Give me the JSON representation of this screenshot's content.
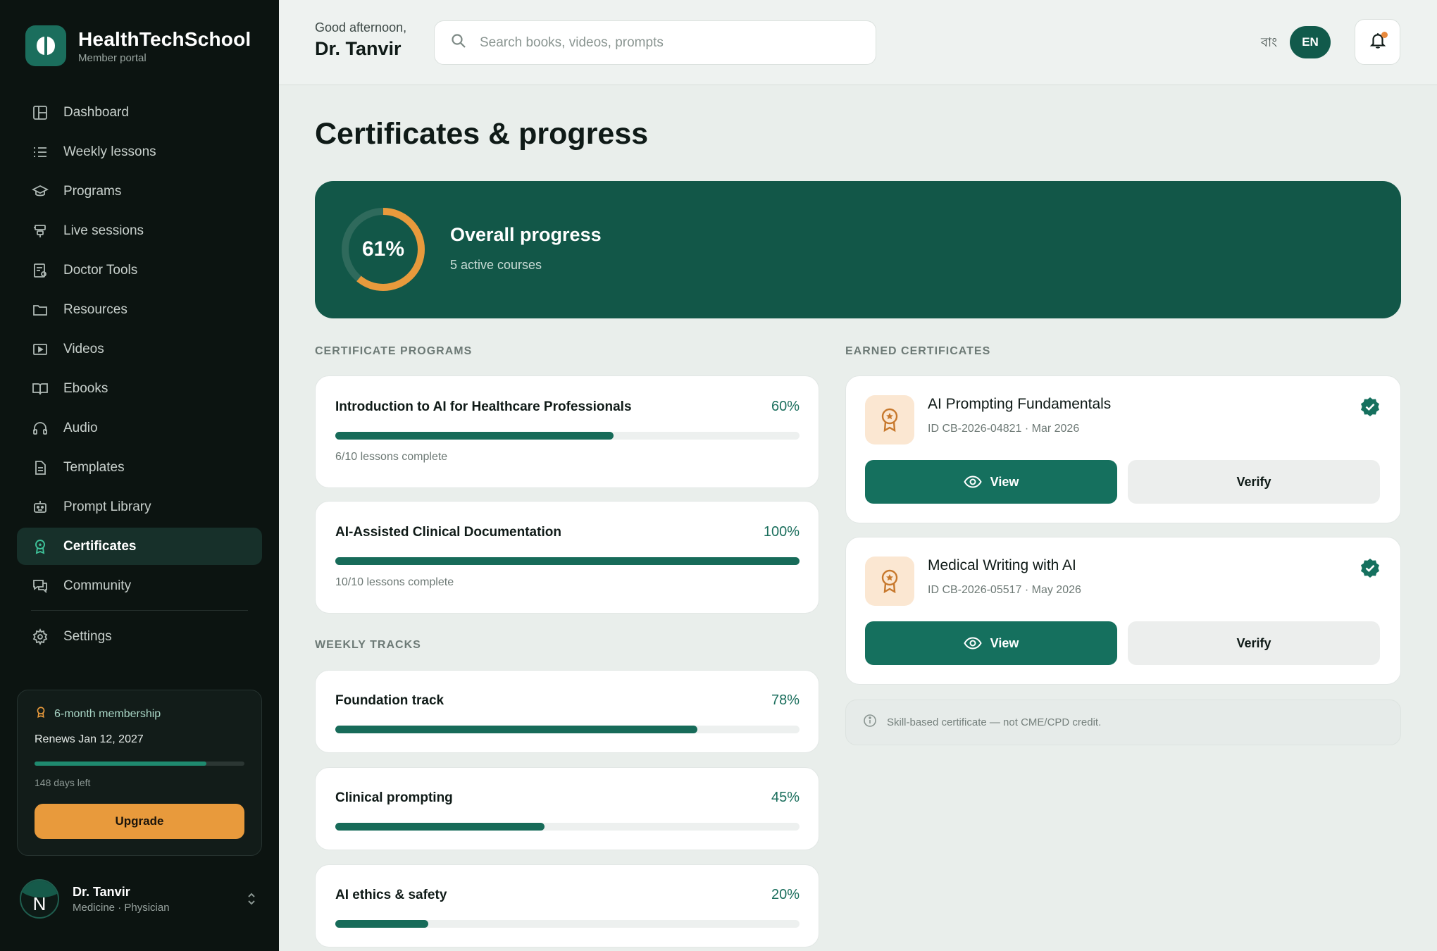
{
  "brand": {
    "name": "HealthTechSchool",
    "subtitle": "Member portal"
  },
  "sidebar": {
    "items": [
      {
        "label": "Dashboard",
        "icon": "dashboard-icon"
      },
      {
        "label": "Weekly lessons",
        "icon": "list-icon"
      },
      {
        "label": "Programs",
        "icon": "graduation-cap-icon"
      },
      {
        "label": "Live sessions",
        "icon": "broadcast-icon"
      },
      {
        "label": "Doctor Tools",
        "icon": "clipboard-icon"
      },
      {
        "label": "Resources",
        "icon": "folder-icon"
      },
      {
        "label": "Videos",
        "icon": "video-icon"
      },
      {
        "label": "Ebooks",
        "icon": "book-icon"
      },
      {
        "label": "Audio",
        "icon": "headphones-icon"
      },
      {
        "label": "Templates",
        "icon": "document-icon"
      },
      {
        "label": "Prompt Library",
        "icon": "robot-icon"
      },
      {
        "label": "Certificates",
        "icon": "award-icon",
        "active": true
      },
      {
        "label": "Community",
        "icon": "chat-icon"
      }
    ],
    "settings_label": "Settings"
  },
  "membership": {
    "title": "6-month membership",
    "renews": "Renews Jan 12, 2027",
    "progress": 0.82,
    "days_left": "148 days left",
    "button": "Upgrade"
  },
  "user": {
    "initial": "N",
    "name": "Dr. Tanvir",
    "role": "Medicine · Physician"
  },
  "header": {
    "greeting": "Good afternoon,",
    "name": "Dr. Tanvir",
    "search_placeholder": "Search books, videos, prompts",
    "lang_bn": "বাং",
    "lang_en": "EN"
  },
  "page": {
    "title": "Certificates & progress"
  },
  "overall": {
    "percent": 61,
    "percent_label": "61%",
    "title": "Overall progress",
    "subtitle": "5 active courses"
  },
  "certificate_programs": {
    "label": "CERTIFICATE PROGRAMS",
    "items": [
      {
        "title": "Introduction to AI for Healthcare Professionals",
        "percent": 60,
        "percent_label": "60%",
        "sub": "6/10 lessons complete"
      },
      {
        "title": "AI-Assisted Clinical Documentation",
        "percent": 100,
        "percent_label": "100%",
        "sub": "10/10 lessons complete"
      }
    ]
  },
  "weekly_tracks": {
    "label": "WEEKLY TRACKS",
    "items": [
      {
        "title": "Foundation track",
        "percent": 78,
        "percent_label": "78%"
      },
      {
        "title": "Clinical prompting",
        "percent": 45,
        "percent_label": "45%"
      },
      {
        "title": "AI ethics & safety",
        "percent": 20,
        "percent_label": "20%"
      }
    ]
  },
  "earned_certificates": {
    "label": "EARNED CERTIFICATES",
    "items": [
      {
        "title": "AI Prompting Fundamentals",
        "id": "ID CB-2026-04821 · Mar 2026",
        "view": "View",
        "verify": "Verify"
      },
      {
        "title": "Medical Writing with AI",
        "id": "ID CB-2026-05517 · May 2026",
        "view": "View",
        "verify": "Verify"
      }
    ],
    "note": "Skill-based certificate — not CME/CPD credit."
  },
  "colors": {
    "primary": "#125748",
    "accent": "#e89a3c",
    "sidebar": "#0c1411"
  }
}
